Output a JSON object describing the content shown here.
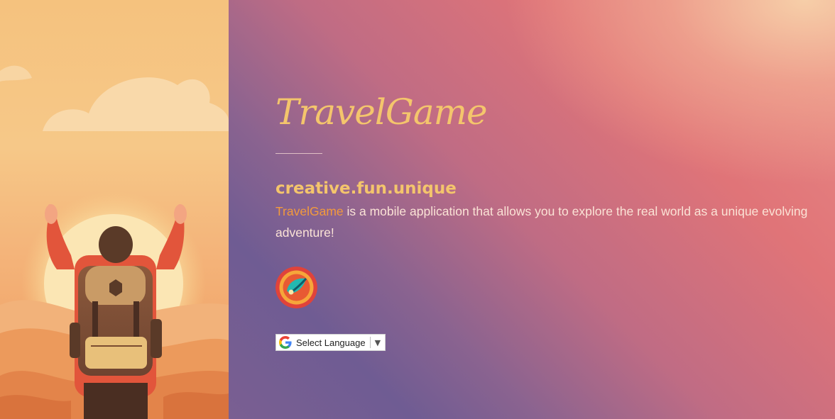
{
  "app": {
    "title": "TravelGame",
    "tagline": "creative.fun.unique",
    "description_brand": "TravelGame",
    "description_text": " is a mobile application that allows you to explore the real world as a unique evolving adventure!"
  },
  "language_selector": {
    "label": "Select Language",
    "caret": "▼"
  },
  "colors": {
    "title": "#f4c56c",
    "brand_highlight": "#f39a3c",
    "body_text": "#fbe3d6"
  },
  "icons": [
    "traveler-illustration",
    "app-badge-icon",
    "google-g-icon",
    "dropdown-caret-icon"
  ]
}
